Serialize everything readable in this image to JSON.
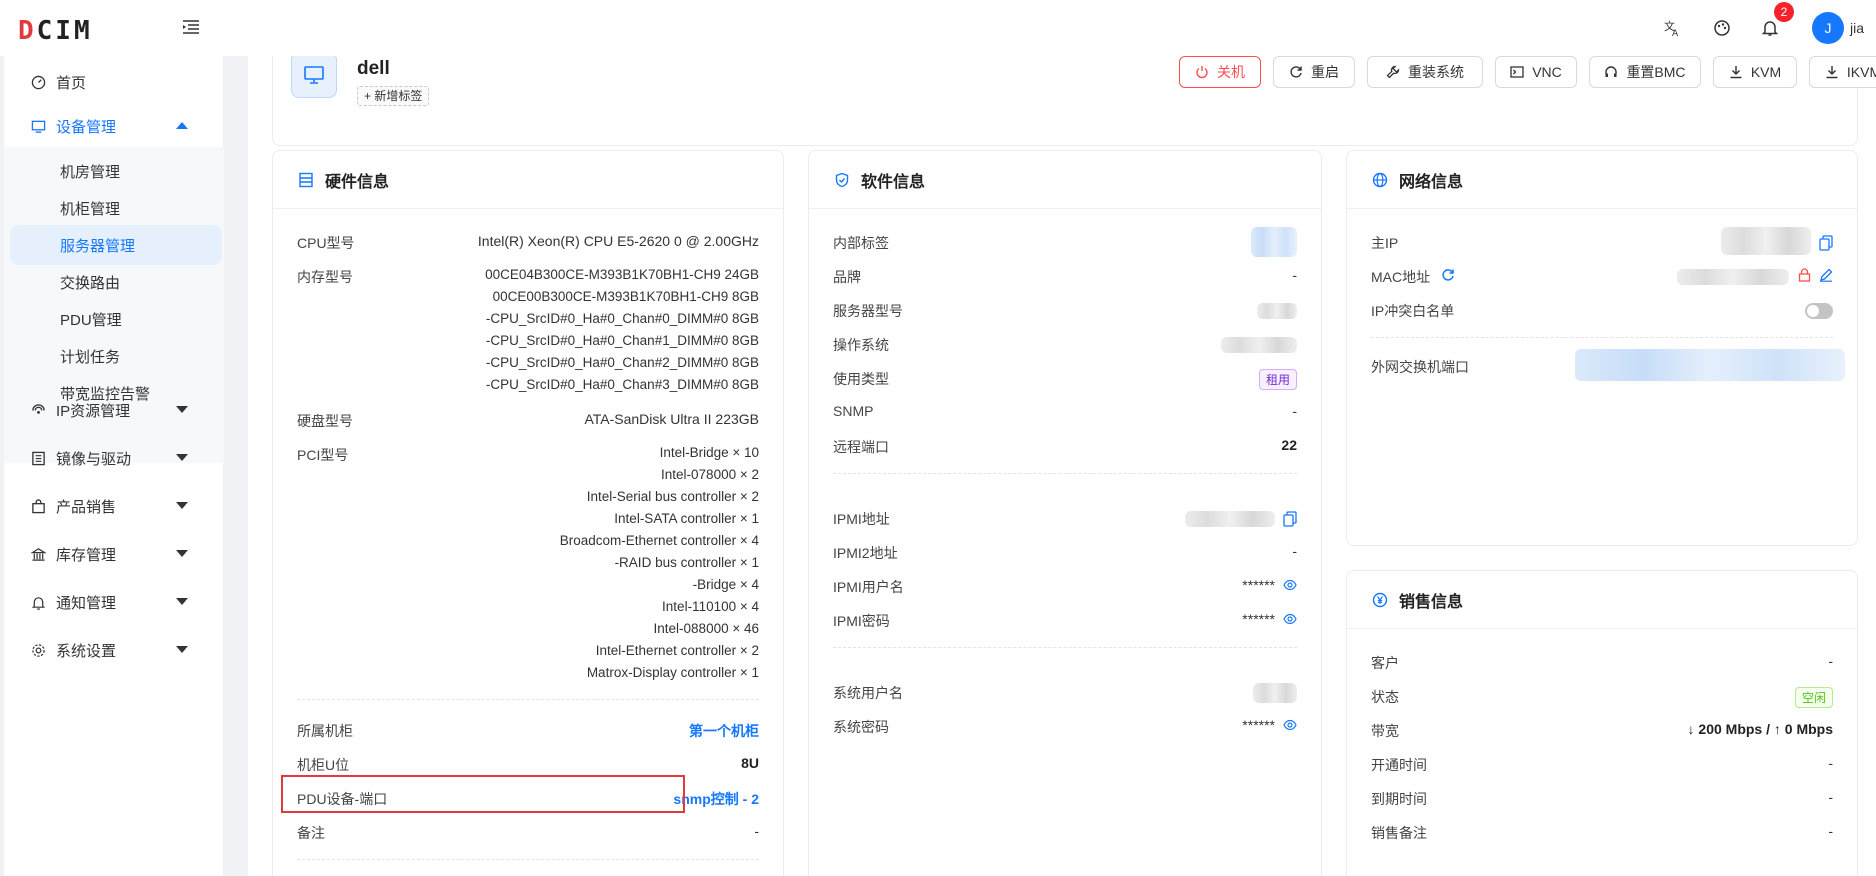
{
  "app": {
    "logo_prefix": "D",
    "logo_rest": "CIM"
  },
  "header": {
    "notification_count": "2",
    "avatar_initial": "J",
    "username": "jia"
  },
  "sidebar": {
    "home": "首页",
    "device_mgmt": "设备管理",
    "sub_items": [
      "机房管理",
      "机柜管理",
      "服务器管理",
      "交换路由",
      "PDU管理",
      "计划任务",
      "带宽监控告警"
    ],
    "ip_mgmt": "IP资源管理",
    "image_driver": "镜像与驱动",
    "product_sales": "产品销售",
    "inventory": "库存管理",
    "notify": "通知管理",
    "settings": "系统设置"
  },
  "device": {
    "name": "dell",
    "add_tag": "+ 新增标签",
    "actions": {
      "shutdown": "关机",
      "reboot": "重启",
      "reinstall": "重装系统",
      "vnc": "VNC",
      "reset_bmc": "重置BMC",
      "kvm": "KVM",
      "ikvm": "IKVM"
    }
  },
  "hardware": {
    "title": "硬件信息",
    "cpu_label": "CPU型号",
    "cpu_value": "Intel(R) Xeon(R) CPU E5-2620 0 @ 2.00GHz",
    "mem_label": "内存型号",
    "mem_values": [
      "00CE04B300CE-M393B1K70BH1-CH9 24GB",
      "00CE00B300CE-M393B1K70BH1-CH9 8GB",
      "-CPU_SrcID#0_Ha#0_Chan#0_DIMM#0 8GB",
      "-CPU_SrcID#0_Ha#0_Chan#1_DIMM#0 8GB",
      "-CPU_SrcID#0_Ha#0_Chan#2_DIMM#0 8GB",
      "-CPU_SrcID#0_Ha#0_Chan#3_DIMM#0 8GB"
    ],
    "disk_label": "硬盘型号",
    "disk_value": "ATA-SanDisk Ultra II 223GB",
    "pci_label": "PCI型号",
    "pci_values": [
      "Intel-Bridge × 10",
      "Intel-078000 × 2",
      "Intel-Serial bus controller × 2",
      "Intel-SATA controller × 1",
      "Broadcom-Ethernet controller × 4",
      "-RAID bus controller × 1",
      "-Bridge × 4",
      "Intel-110100 × 4",
      "Intel-088000 × 46",
      "Intel-Ethernet controller × 2",
      "Matrox-Display controller × 1"
    ],
    "cabinet_label": "所属机柜",
    "cabinet_value": "第一个机柜",
    "u_label": "机柜U位",
    "u_value": "8U",
    "pdu_label": "PDU设备-端口",
    "pdu_value": "snmp控制 - 2",
    "note_label": "备注",
    "note_value": "-"
  },
  "software": {
    "title": "软件信息",
    "internal_tag": "内部标签",
    "brand": "品牌",
    "brand_value": "-",
    "server_model": "服务器型号",
    "os": "操作系统",
    "usage_type": "使用类型",
    "usage_value": "租用",
    "snmp": "SNMP",
    "snmp_value": "-",
    "remote_port": "远程端口",
    "remote_port_value": "22",
    "ipmi_addr": "IPMI地址",
    "ipmi2_addr": "IPMI2地址",
    "ipmi2_value": "-",
    "ipmi_user": "IPMI用户名",
    "ipmi_user_value": "******",
    "ipmi_pwd": "IPMI密码",
    "ipmi_pwd_value": "******",
    "sys_user": "系统用户名",
    "sys_pwd": "系统密码",
    "sys_pwd_value": "******"
  },
  "network": {
    "title": "网络信息",
    "main_ip": "主IP",
    "mac": "MAC地址",
    "ip_whitelist": "IP冲突白名单",
    "switch_port": "外网交换机端口"
  },
  "sales": {
    "title": "销售信息",
    "customer": "客户",
    "customer_value": "-",
    "status": "状态",
    "status_value": "空闲",
    "bandwidth": "带宽",
    "bandwidth_value": "↓ 200 Mbps / ↑ 0 Mbps",
    "open_time": "开通时间",
    "open_time_value": "-",
    "expire_time": "到期时间",
    "expire_time_value": "-",
    "sales_note": "销售备注",
    "sales_note_value": "-"
  }
}
